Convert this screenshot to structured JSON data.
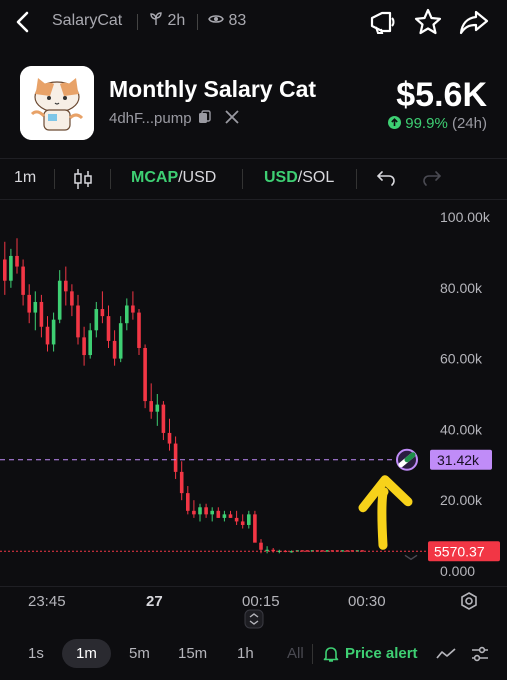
{
  "header": {
    "token_symbol": "SalaryCat",
    "age": "2h",
    "holders": "83"
  },
  "token": {
    "name": "Monthly Salary Cat",
    "address": "4dhF...pump",
    "price": "$5.6K",
    "change_pct": "99.9%",
    "change_period": "(24h)"
  },
  "toolbar": {
    "interval": "1m",
    "mcap": "MCAP",
    "mcap_unit": "/USD",
    "usd": "USD",
    "usd_unit": "/SOL"
  },
  "chart": {
    "y_ticks": [
      "100.00k",
      "80.00k",
      "60.00k",
      "40.00k",
      "20.00k",
      "0.000"
    ],
    "marker_label": "31.42k",
    "marker_value": 31.42,
    "last_price_label": "5570.37",
    "last_price_value": 5.57,
    "x_ticks": [
      "23:45",
      "27",
      "00:15",
      "00:30"
    ]
  },
  "bottombar": {
    "intervals": [
      "1s",
      "1m",
      "5m",
      "15m",
      "1h",
      "All"
    ],
    "active_interval": "1m",
    "price_alert": "Price alert"
  },
  "colors": {
    "up": "#3ecf73",
    "down": "#f23645",
    "marker": "#c08cf8",
    "price_line": "#f23645"
  },
  "chart_data": {
    "type": "candlestick",
    "ylim": [
      0,
      100
    ],
    "y_unit": "k USD",
    "series": [
      {
        "values": [
          [
            88,
            93,
            78,
            82
          ],
          [
            82,
            91,
            80,
            89
          ],
          [
            89,
            94,
            84,
            86
          ],
          [
            86,
            88,
            75,
            78
          ],
          [
            78,
            81,
            70,
            73
          ],
          [
            73,
            79,
            68,
            76
          ],
          [
            76,
            78,
            66,
            69
          ],
          [
            69,
            72,
            62,
            64
          ],
          [
            64,
            73,
            62,
            71
          ],
          [
            71,
            85,
            70,
            82
          ],
          [
            82,
            86,
            75,
            79
          ],
          [
            79,
            81,
            72,
            75
          ],
          [
            75,
            78,
            64,
            66
          ],
          [
            66,
            69,
            58,
            61
          ],
          [
            61,
            70,
            60,
            68
          ],
          [
            68,
            76,
            66,
            74
          ],
          [
            74,
            79,
            70,
            72
          ],
          [
            72,
            75,
            63,
            65
          ],
          [
            65,
            68,
            58,
            60
          ],
          [
            60,
            72,
            59,
            70
          ],
          [
            70,
            77,
            68,
            75
          ],
          [
            75,
            79,
            71,
            73
          ],
          [
            73,
            74,
            61,
            63
          ],
          [
            63,
            64,
            46,
            48
          ],
          [
            48,
            53,
            43,
            45
          ],
          [
            45,
            50,
            41,
            47
          ],
          [
            47,
            48,
            37,
            39
          ],
          [
            39,
            43,
            34,
            36
          ],
          [
            36,
            38,
            26,
            28
          ],
          [
            28,
            31,
            20,
            22
          ],
          [
            22,
            24,
            16,
            17
          ],
          [
            17,
            20,
            15,
            16
          ],
          [
            16,
            19,
            14,
            18
          ],
          [
            18,
            19,
            15,
            16
          ],
          [
            16,
            18,
            14,
            17
          ],
          [
            17,
            18,
            15,
            15
          ],
          [
            15,
            17,
            14,
            16
          ],
          [
            16,
            17,
            15,
            15
          ],
          [
            15,
            17,
            13,
            14
          ],
          [
            14,
            16,
            12,
            13
          ],
          [
            13,
            17,
            12,
            16
          ],
          [
            16,
            17,
            12,
            8
          ],
          [
            8,
            9,
            5,
            6
          ],
          [
            6,
            7,
            5,
            6
          ],
          [
            6,
            6.5,
            5.2,
            5.6
          ],
          [
            5.6,
            6,
            5,
            5.7
          ],
          [
            5.7,
            5.9,
            5.3,
            5.5
          ],
          [
            5.5,
            5.8,
            5.2,
            5.6
          ]
        ]
      }
    ]
  }
}
